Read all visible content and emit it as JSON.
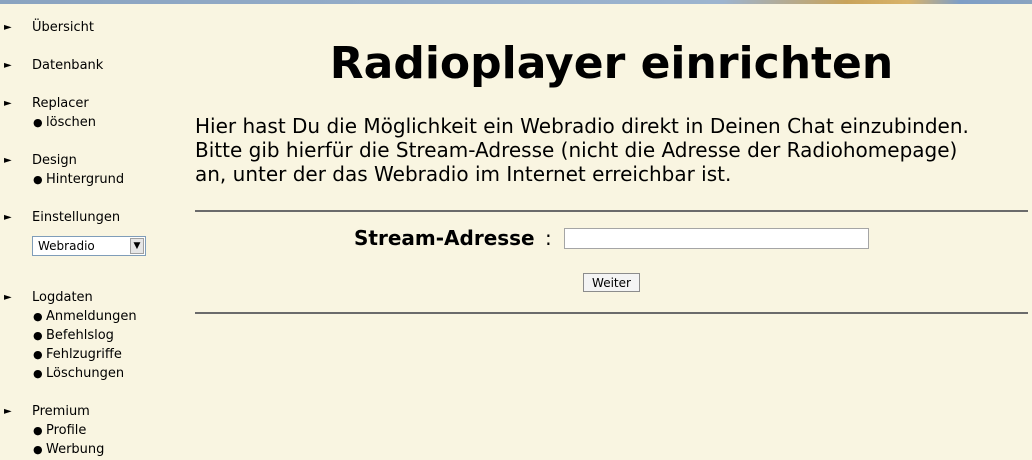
{
  "sidebar": {
    "uebersicht": "Übersicht",
    "datenbank": "Datenbank",
    "replacer": {
      "label": "Replacer",
      "items": [
        "löschen"
      ]
    },
    "design": {
      "label": "Design",
      "items": [
        "Hintergrund"
      ]
    },
    "einstellungen": {
      "label": "Einstellungen",
      "selected": "Webradio"
    },
    "logdaten": {
      "label": "Logdaten",
      "items": [
        "Anmeldungen",
        "Befehlslog",
        "Fehlzugriffe",
        "Löschungen"
      ]
    },
    "premium": {
      "label": "Premium",
      "items": [
        "Profile",
        "Werbung"
      ]
    },
    "arrow_glyph": "►",
    "bullet_glyph": "●"
  },
  "main": {
    "title": "Radioplayer einrichten",
    "intro_lines": [
      "Hier hast Du die Möglichkeit ein Webradio direkt in Deinen Chat einzubinden.",
      "Bitte gib hierfür die Stream-Adresse (nicht die Adresse der Radiohomepage)",
      "an, unter der das Webradio im Internet erreichbar ist."
    ],
    "stream_label": "Stream-Adresse",
    "colon": ":",
    "stream_value": "",
    "submit_label": "Weiter"
  },
  "icons": {
    "nav_arrow": "arrow-right-icon",
    "list_bullet": "bullet-icon",
    "dropdown": "chevron-down-icon"
  },
  "colors": {
    "background": "#f9f5e1",
    "rule": "#6b6b6b",
    "text": "#000000"
  }
}
